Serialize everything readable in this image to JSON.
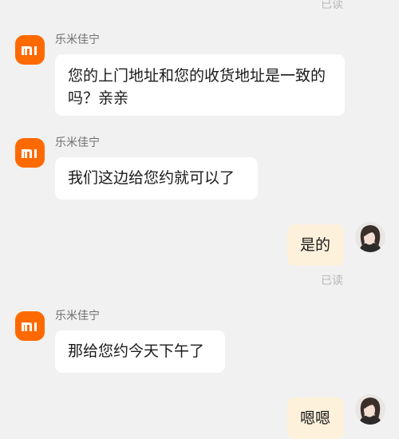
{
  "read_label": "已读",
  "messages": [
    {
      "sender": "乐米佳宁",
      "text": "您的上门地址和您的收货地址是一致的吗？亲亲"
    },
    {
      "sender": "乐米佳宁",
      "text": "我们这边给您约就可以了"
    },
    {
      "sender": "me",
      "text": "是的"
    },
    {
      "sender": "乐米佳宁",
      "text": "那给您约今天下午了"
    },
    {
      "sender": "me",
      "text": "嗯嗯"
    }
  ],
  "icons": {
    "agent_avatar": "xiaomi-logo-icon",
    "user_avatar": "user-avatar"
  },
  "colors": {
    "background": "#f1f1f1",
    "agent_bubble": "#ffffff",
    "user_bubble": "#fdf1dc",
    "brand": "#ff6a00"
  }
}
